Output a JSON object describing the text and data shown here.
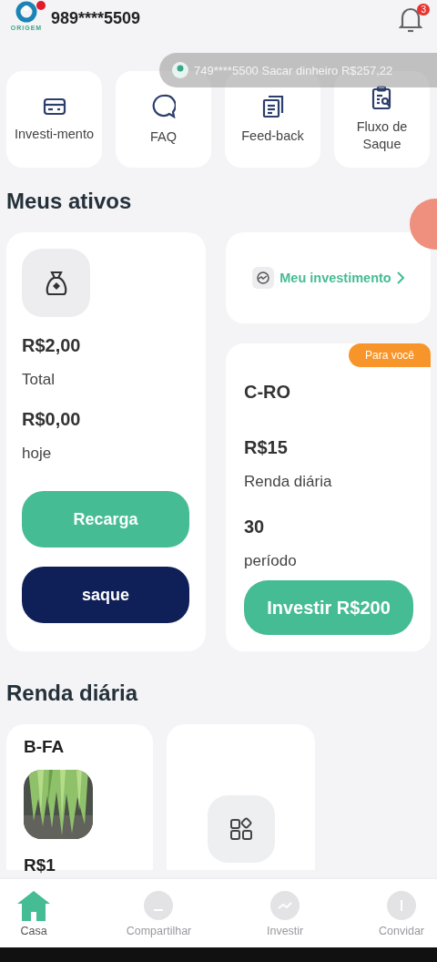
{
  "header": {
    "logo_text": "ORIGEM",
    "account": "989****5509",
    "notifications": "3"
  },
  "ticker": {
    "text": "749****5500 Sacar dinheiro R$257,22"
  },
  "shortcuts": [
    {
      "kind": "card",
      "label": "Investi-mento"
    },
    {
      "kind": "faq",
      "label": "FAQ"
    },
    {
      "kind": "docs",
      "label": "Feed-back"
    },
    {
      "kind": "report",
      "label": "Fluxo de Saque"
    }
  ],
  "assets": {
    "title": "Meus ativos",
    "total_value": "R$2,00",
    "total_label": "Total",
    "today_value": "R$0,00",
    "today_label": "hoje",
    "buttons": [
      {
        "kind": "primary",
        "label": "Recarga"
      },
      {
        "kind": "dark",
        "label": "saque"
      }
    ],
    "link": "Meu investimento",
    "offer": {
      "tag": "Para você",
      "name": "C-RO",
      "income": "R$15",
      "income_label": "Renda diária",
      "period": "30",
      "period_label": "período",
      "button": "Investir R$200"
    }
  },
  "daily": {
    "title": "Renda diária",
    "products": [
      {
        "kind": "product",
        "name": "B-FA",
        "price": "R$1"
      },
      {
        "kind": "more"
      }
    ]
  },
  "nav": [
    {
      "kind": "home",
      "label": "Casa",
      "selected": true
    },
    {
      "kind": "share",
      "label": "Compartilhar",
      "selected": false
    },
    {
      "kind": "invest",
      "label": "Investir",
      "selected": false
    },
    {
      "kind": "invite",
      "label": "Convidar",
      "selected": false
    }
  ]
}
